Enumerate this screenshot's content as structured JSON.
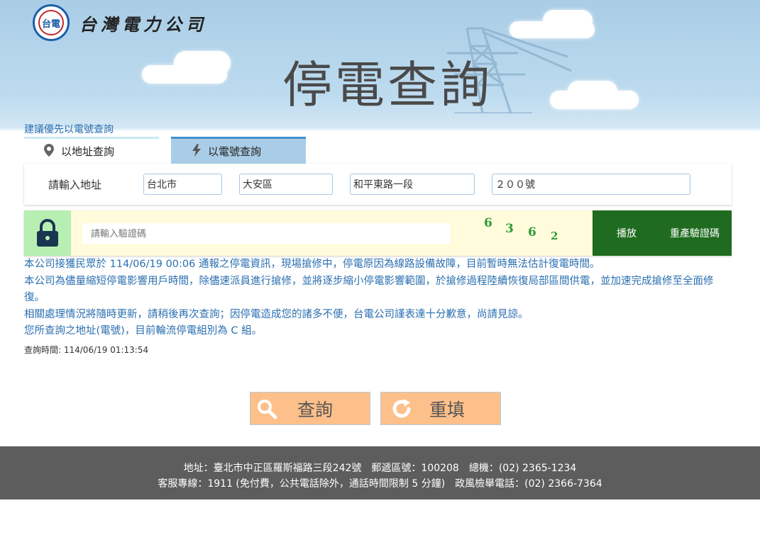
{
  "brand": {
    "logo_text": "台灣電力公司",
    "logo_mark": "台電"
  },
  "header": {
    "title": "停電查詢"
  },
  "hint_text": "建議優先以電號查詢",
  "tabs": [
    {
      "label": "以地址查詢",
      "icon": "map-pin-icon",
      "active": true
    },
    {
      "label": "以電號查詢",
      "icon": "lightning-icon",
      "active": false
    }
  ],
  "address_form": {
    "label": "請輸入地址",
    "city": "台北市",
    "district": "大安區",
    "road": "和平東路一段",
    "number": "２００號"
  },
  "captcha": {
    "placeholder": "請輸入驗證碼",
    "value": "",
    "chars": [
      "6",
      "3",
      "6",
      "2"
    ],
    "play_label": "播放",
    "refresh_label": "重產驗證碼"
  },
  "messages": [
    "本公司接獲民眾於 114/06/19 00:06 通報之停電資訊，現場搶修中，停電原因為線路設備故障，目前暫時無法估計復電時間。",
    "本公司為儘量縮短停電影響用戶時間，除儘速派員進行搶修，並將逐步縮小停電影響範圍，於搶修過程陸續恢復局部區間供電，並加速完成搶修至全面修復。",
    "相關處理情況將隨時更新，請稍後再次查詢；因停電造成您的諸多不便，台電公司謹表達十分歉意，尚請見諒。",
    "您所查詢之地址(電號)，目前輪流停電組別為 C 組。"
  ],
  "query_time": "查詢時間: 114/06/19 01:13:54",
  "actions": {
    "search_label": "查詢",
    "reset_label": "重填"
  },
  "footer": {
    "line1": "地址：臺北市中正區羅斯福路三段242號　郵遞區號：100208　總機：(02) 2365-1234",
    "line2": "客服專線：1911 (免付費，公共電話除外，通話時間限制 5 分鐘)　政風檢舉電話：(02) 2366-7364"
  },
  "colors": {
    "sky": "#a9cde6",
    "link_blue": "#2b6fb0",
    "button_orange": "#fdc08a",
    "captcha_green": "#1f6b1f",
    "lock_green": "#b7efb3",
    "footer_gray": "#5d5d5d"
  }
}
